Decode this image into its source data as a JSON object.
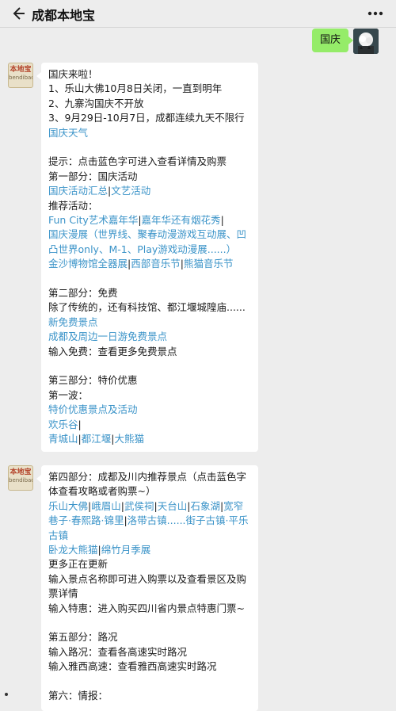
{
  "header": {
    "title": "成都本地宝"
  },
  "outgoing": {
    "text": "国庆"
  },
  "message1": {
    "lines": [
      {
        "t": "text",
        "v": "国庆来啦！"
      },
      {
        "t": "text",
        "v": "1、乐山大佛10月8日关闭，一直到明年"
      },
      {
        "t": "text",
        "v": "2、九寨沟国庆不开放"
      },
      {
        "t": "text",
        "v": "3、9月29日-10月7日，成都连续九天不限行"
      },
      {
        "t": "link",
        "v": "国庆天气"
      },
      {
        "t": "blank"
      },
      {
        "t": "text",
        "v": "提示：点击蓝色字可进入查看详情及购票"
      },
      {
        "t": "text",
        "v": "第一部分：国庆活动"
      },
      {
        "t": "links",
        "v": [
          "国庆活动汇总",
          "文艺活动"
        ]
      },
      {
        "t": "text",
        "v": "推荐活动："
      },
      {
        "t": "links",
        "v": [
          "Fun City艺术嘉年华",
          "嘉年华还有烟花秀",
          ""
        ]
      },
      {
        "t": "link",
        "v": "国庆漫展（世界线、聚春动漫游戏互动展、凹凸世界only、M-1、Play游戏动漫展......）"
      },
      {
        "t": "links",
        "v": [
          "金沙博物馆全器展",
          "西部音乐节",
          "熊猫音乐节"
        ]
      },
      {
        "t": "blank"
      },
      {
        "t": "text",
        "v": "第二部分：免费"
      },
      {
        "t": "text",
        "v": "除了传统的，还有科技馆、都江堰城隍庙......"
      },
      {
        "t": "link",
        "v": "新免费景点"
      },
      {
        "t": "link",
        "v": "成都及周边一日游免费景点"
      },
      {
        "t": "text",
        "v": "输入免费：查看更多免费景点"
      },
      {
        "t": "blank"
      },
      {
        "t": "text",
        "v": "第三部分：特价优惠"
      },
      {
        "t": "text",
        "v": "第一波："
      },
      {
        "t": "link",
        "v": "特价优惠景点及活动"
      },
      {
        "t": "links",
        "v": [
          "欢乐谷",
          ""
        ]
      },
      {
        "t": "links",
        "v": [
          "青城山",
          "都江堰",
          "大熊猫"
        ]
      }
    ]
  },
  "message2": {
    "lines": [
      {
        "t": "text",
        "v": "第四部分：成都及川内推荐景点（点击蓝色字体查看攻略或者购票~）"
      },
      {
        "t": "links",
        "v": [
          "乐山大佛",
          "峨眉山",
          "武侯祠",
          "天台山",
          "石象湖",
          "宽窄巷子·春熙路·锦里",
          "洛带古镇......街子古镇·平乐古镇"
        ]
      },
      {
        "t": "links",
        "v": [
          "卧龙大熊猫",
          "绵竹月季展"
        ]
      },
      {
        "t": "text",
        "v": "更多正在更新"
      },
      {
        "t": "text",
        "v": "输入景点名称即可进入购票以及查看景区及购票详情"
      },
      {
        "t": "text",
        "v": "输入特惠：进入购买四川省内景点特惠门票~"
      },
      {
        "t": "blank"
      },
      {
        "t": "text",
        "v": "第五部分：路况"
      },
      {
        "t": "text",
        "v": "输入路况：查看各高速实时路况"
      },
      {
        "t": "text",
        "v": "输入雅西高速：查看雅西高速实时路况"
      },
      {
        "t": "blank"
      },
      {
        "t": "text",
        "v": "第六：情报："
      }
    ]
  },
  "bot_avatar": {
    "line1": "本地宝",
    "line2": "bendibao.com"
  },
  "colors": {
    "accent_link": "#576b95",
    "outgoing_bubble": "#95ec69",
    "background": "#ededed"
  }
}
